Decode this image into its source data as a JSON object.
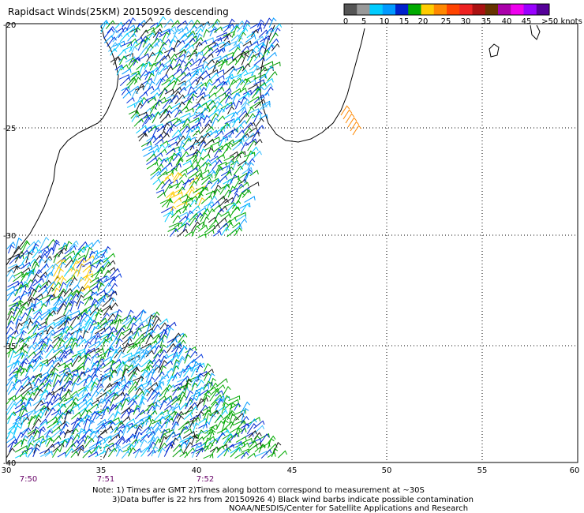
{
  "title": "Rapidsact Winds(25KM) 20150926 descending",
  "legend": {
    "labels": [
      "0",
      "5",
      "10",
      "15",
      "20",
      "25",
      "30",
      "35",
      "40",
      "45",
      ">50 knots"
    ],
    "colors": [
      "#555555",
      "#999999",
      "#00ccff",
      "#0099ff",
      "#0022cc",
      "#00aa00",
      "#ffcc00",
      "#ff8800",
      "#ff4400",
      "#ee2222",
      "#aa1111",
      "#663300",
      "#aa00aa",
      "#ee00ee",
      "#9900ff",
      "#550099"
    ]
  },
  "axes": {
    "x_ticks": [
      "30",
      "35",
      "40",
      "45",
      "50",
      "55",
      "60"
    ],
    "y_ticks": [
      "-20",
      "-25",
      "-30",
      "-35",
      "-40"
    ]
  },
  "time_labels": [
    "7:50",
    "7:51",
    "7:52"
  ],
  "notes": [
    "Note: 1) Times are GMT 2)Times along bottom correspond to measurement at ~30S",
    "3)Data buffer is 22 hrs from 20150926 4) Black wind barbs indicate possible contamination",
    "NOAA/NESDIS/Center for Satellite Applications and Research"
  ]
}
